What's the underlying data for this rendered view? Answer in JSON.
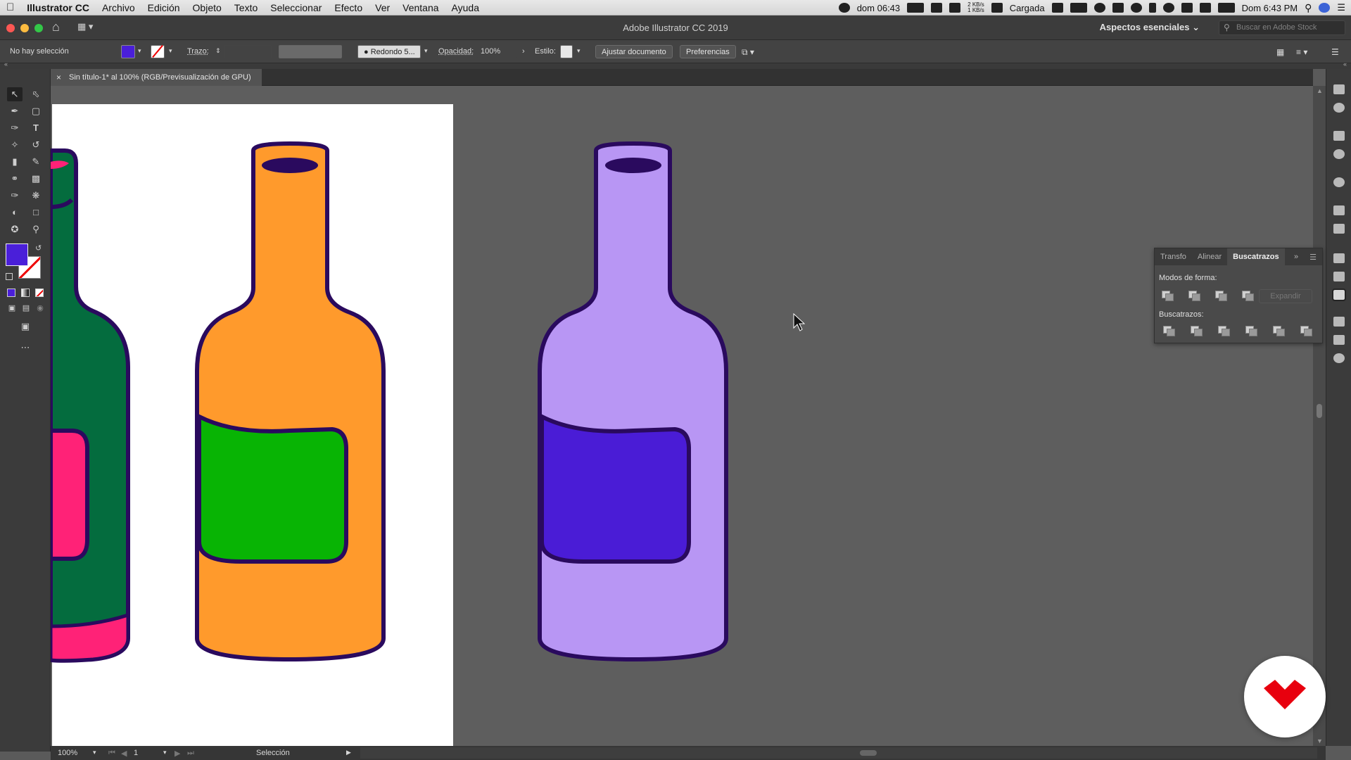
{
  "menubar": {
    "app_name": "Illustrator CC",
    "items": [
      "Archivo",
      "Edición",
      "Objeto",
      "Texto",
      "Seleccionar",
      "Efecto",
      "Ver",
      "Ventana",
      "Ayuda"
    ],
    "clock_short": "dom 06:43",
    "net_speed": "2 KB/s\n1 KB/s",
    "battery_status": "Cargada",
    "clock_full": "Dom 6:43 PM"
  },
  "window": {
    "title": "Adobe Illustrator CC 2019",
    "workspace": "Aspectos esenciales",
    "stock_search_placeholder": "Buscar en Adobe Stock"
  },
  "control_bar": {
    "selection_status": "No hay selección",
    "fill_color": "#4a1fd9",
    "stroke_label": "Trazo:",
    "brush_label": "Redondo 5...",
    "opacity_label": "Opacidad:",
    "opacity_value": "100%",
    "style_label": "Estilo:",
    "doc_setup_button": "Ajustar documento",
    "preferences_button": "Preferencias"
  },
  "document": {
    "tab_title": "Sin título-1* al 100% (RGB/Previsualización de GPU)"
  },
  "pathfinder": {
    "tabs": [
      "Transfo",
      "Alinear",
      "Buscatrazos"
    ],
    "active_tab": "Buscatrazos",
    "shape_modes_label": "Modos de forma:",
    "expand_button": "Expandir",
    "pathfinders_label": "Buscatrazos:"
  },
  "status_bar": {
    "zoom": "100%",
    "artboard_number": "1",
    "tool_name": "Selección"
  },
  "colors": {
    "outline": "#2a0a5e",
    "green_bottle": "#046c3e",
    "pink": "#ff2277",
    "orange_bottle": "#ff9a2c",
    "green_label": "#08b404",
    "purple_bottle": "#b896f4",
    "purple_label": "#4a1cd6",
    "accent_red": "#e8000e"
  }
}
